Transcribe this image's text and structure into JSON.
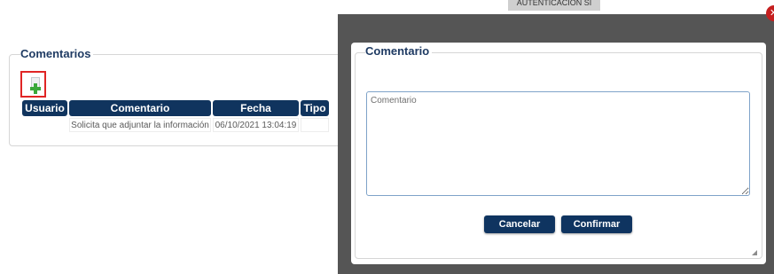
{
  "comments_panel": {
    "title": "Comentarios",
    "columns": [
      "Usuario",
      "Comentario",
      "Fecha",
      "Tipo"
    ],
    "rows": [
      {
        "usuario": "",
        "comentario": "Solicita que adjuntar la información",
        "fecha": "06/10/2021 13:04:19",
        "tipo": ""
      }
    ]
  },
  "background_tab": {
    "label": "AUTENTICACIÓN  SI"
  },
  "dialog": {
    "title": "Comentario",
    "textarea_placeholder": "Comentario",
    "textarea_value": "",
    "cancel_label": "Cancelar",
    "confirm_label": "Confirmar",
    "close_icon": "close-icon"
  },
  "colors": {
    "header_blue": "#10345e",
    "title_blue": "#1f3b63",
    "overlay": "#555555",
    "highlight_red": "#e02525",
    "add_green": "#3aa83a"
  }
}
